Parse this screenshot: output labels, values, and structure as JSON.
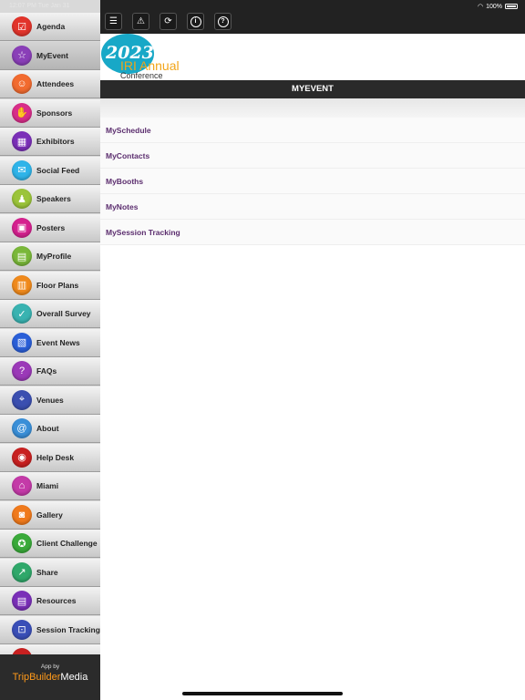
{
  "status_bar": {
    "time": "12:07 PM   Tue Jan 31",
    "battery": "100%"
  },
  "sidebar": {
    "items": [
      {
        "label": "Agenda",
        "icon": "calendar-check-icon",
        "color": "#e2342b",
        "glyph": "☑"
      },
      {
        "label": "MyEvent",
        "icon": "star-icon",
        "color": "#8a3fb8",
        "glyph": "☆"
      },
      {
        "label": "Attendees",
        "icon": "people-icon",
        "color": "#f26b2f",
        "glyph": "☺"
      },
      {
        "label": "Sponsors",
        "icon": "handshake-icon",
        "color": "#d92e8a",
        "glyph": "✋"
      },
      {
        "label": "Exhibitors",
        "icon": "booth-icon",
        "color": "#7b2fb8",
        "glyph": "▦"
      },
      {
        "label": "Social Feed",
        "icon": "chat-icon",
        "color": "#2fb4e9",
        "glyph": "✉"
      },
      {
        "label": "Speakers",
        "icon": "speaker-icon",
        "color": "#9bc43a",
        "glyph": "♟"
      },
      {
        "label": "Posters",
        "icon": "poster-icon",
        "color": "#d5218f",
        "glyph": "▣"
      },
      {
        "label": "MyProfile",
        "icon": "profile-card-icon",
        "color": "#7ab83a",
        "glyph": "▤"
      },
      {
        "label": "Floor Plans",
        "icon": "floor-plan-icon",
        "color": "#f08a1c",
        "glyph": "▥"
      },
      {
        "label": "Overall Survey",
        "icon": "thumbs-up-icon",
        "color": "#39b3b1",
        "glyph": "✓"
      },
      {
        "label": "Event News",
        "icon": "newspaper-icon",
        "color": "#2a5fd8",
        "glyph": "▧"
      },
      {
        "label": "FAQs",
        "icon": "speech-bubble-icon",
        "color": "#9b39b8",
        "glyph": "?"
      },
      {
        "label": "Venues",
        "icon": "location-pin-icon",
        "color": "#3b4fb0",
        "glyph": "⌖"
      },
      {
        "label": "About",
        "icon": "at-sign-icon",
        "color": "#3a8fd8",
        "glyph": "@"
      },
      {
        "label": "Help Desk",
        "icon": "lifebuoy-icon",
        "color": "#c82020",
        "glyph": "◉"
      },
      {
        "label": "Miami",
        "icon": "city-icon",
        "color": "#c43aa8",
        "glyph": "⌂"
      },
      {
        "label": "Gallery",
        "icon": "camera-icon",
        "color": "#f07a1c",
        "glyph": "◙"
      },
      {
        "label": "Client Challenge",
        "icon": "award-icon",
        "color": "#3aaa3a",
        "glyph": "✪"
      },
      {
        "label": "Share",
        "icon": "share-icon",
        "color": "#2fa86a",
        "glyph": "↗"
      },
      {
        "label": "Resources",
        "icon": "documents-icon",
        "color": "#7a2fb8",
        "glyph": "▤"
      },
      {
        "label": "Session Tracking",
        "icon": "tracking-icon",
        "color": "#3a4fb8",
        "glyph": "⊡"
      },
      {
        "label": "",
        "icon": "partial-item-icon",
        "color": "#c82020",
        "glyph": ""
      }
    ],
    "brand": {
      "app_by": "App by",
      "trip": "TripBuilder",
      "media": "Media"
    }
  },
  "toolbar": {
    "menu_icon": "☰",
    "alert_icon": "⚠",
    "sync_icon": "⟳",
    "info_icon": "i",
    "help_icon": "?"
  },
  "logo": {
    "year": "2023",
    "line1": "IRI Annual",
    "line2": "Conference"
  },
  "page": {
    "title": "MYEVENT",
    "items": [
      "MySchedule",
      "MyContacts",
      "MyBooths",
      "MyNotes",
      "MySession Tracking"
    ]
  }
}
